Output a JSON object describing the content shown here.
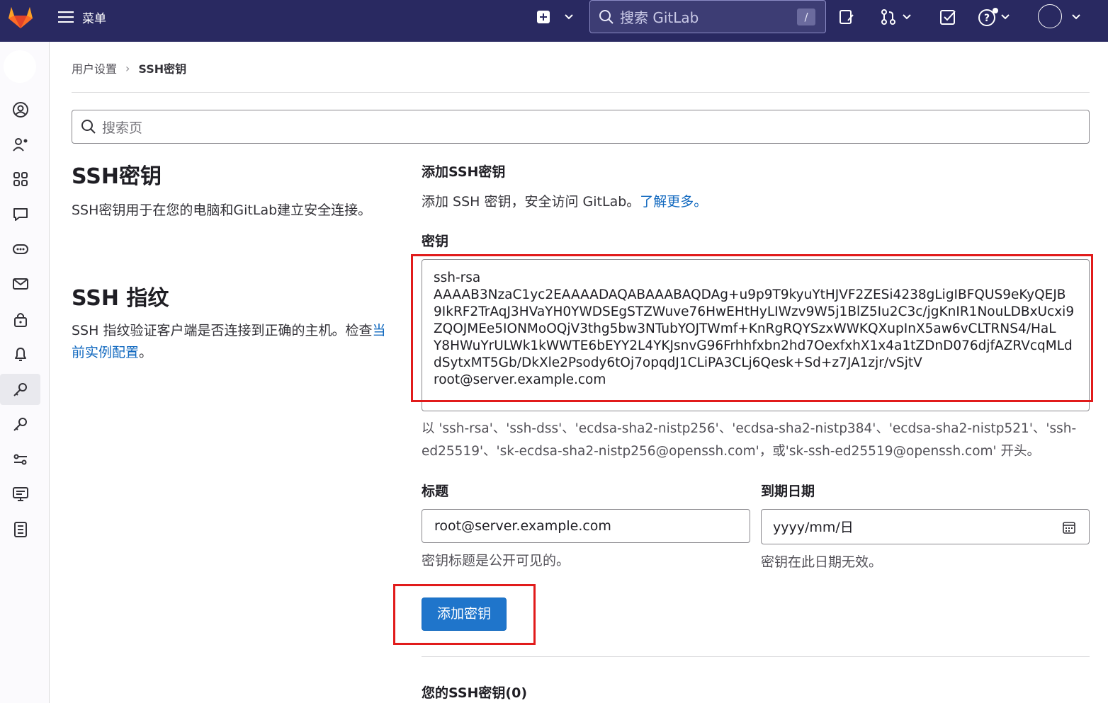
{
  "topbar": {
    "menu_label": "菜单",
    "search_placeholder": "搜索 GitLab",
    "search_shortcut": "/"
  },
  "breadcrumb": {
    "parent": "用户设置",
    "current": "SSH密钥"
  },
  "page_search": {
    "placeholder": "搜索页"
  },
  "left": {
    "ssh_heading": "SSH密钥",
    "ssh_desc": "SSH密钥用于在您的电脑和GitLab建立安全连接。",
    "fp_heading": "SSH 指纹",
    "fp_desc": "SSH 指纹验证客户端是否连接到正确的主机。检查",
    "fp_link": "当前实例配置",
    "fp_end": "。"
  },
  "form": {
    "title": "添加SSH密钥",
    "desc": "添加 SSH 密钥，安全访问 GitLab。",
    "learn_more": "了解更多。",
    "key_label": "密钥",
    "key_lines": [
      "ssh-rsa",
      "AAAAB3NzaC1yc2EAAAADAQABAAABAQDAg+u9p9T9kyuYtHJVF2ZESi4238gLigIBFQUS9eKyQEJB",
      "9IkRF2TrAqJ3HVaYH0YWDSEgSTZWuve76HwEHtHyLIWzv9W5j1BlZ5Iu2C3c/jgKnIR1NouLDBxUcxi9",
      "ZQOJMEe5IONMoOQjV3thg5bw3NTubYOJTWmf+KnRgRQYSzxWWKQXupInX5aw6vCLTRNS4/HaL",
      "Y8HWuYrULWk1kWWTE6bEYY2L4YKJsnvG96Frhhfxbn2hd7OexfxhX1x4a1tZDnD076djfAZRVcqMLd",
      "dSytxMT5Gb/DkXle2Psody6tOj7opqdJ1CLiPA3CLj6Qesk+Sd+z7JA1zjr/vSjtV",
      "root@server.example.com"
    ],
    "key_hint": "以 'ssh-rsa'、'ssh-dss'、'ecdsa-sha2-nistp256'、'ecdsa-sha2-nistp384'、'ecdsa-sha2-nistp521'、'ssh-ed25519'、'sk-ecdsa-sha2-nistp256@openssh.com'，或'sk-ssh-ed25519@openssh.com' 开头。",
    "title_label": "标题",
    "title_value": "root@server.example.com",
    "title_help": "密钥标题是公开可见的。",
    "expiry_label": "到期日期",
    "expiry_placeholder": "yyyy/mm/日",
    "expiry_help": "密钥在此日期无效。",
    "submit_label": "添加密钥"
  },
  "keys_list": {
    "heading": "您的SSH密钥(0)"
  },
  "colors": {
    "topbar": "#292961",
    "primary": "#1f75cb",
    "link": "#1068bf",
    "highlight": "#e11b1b"
  }
}
